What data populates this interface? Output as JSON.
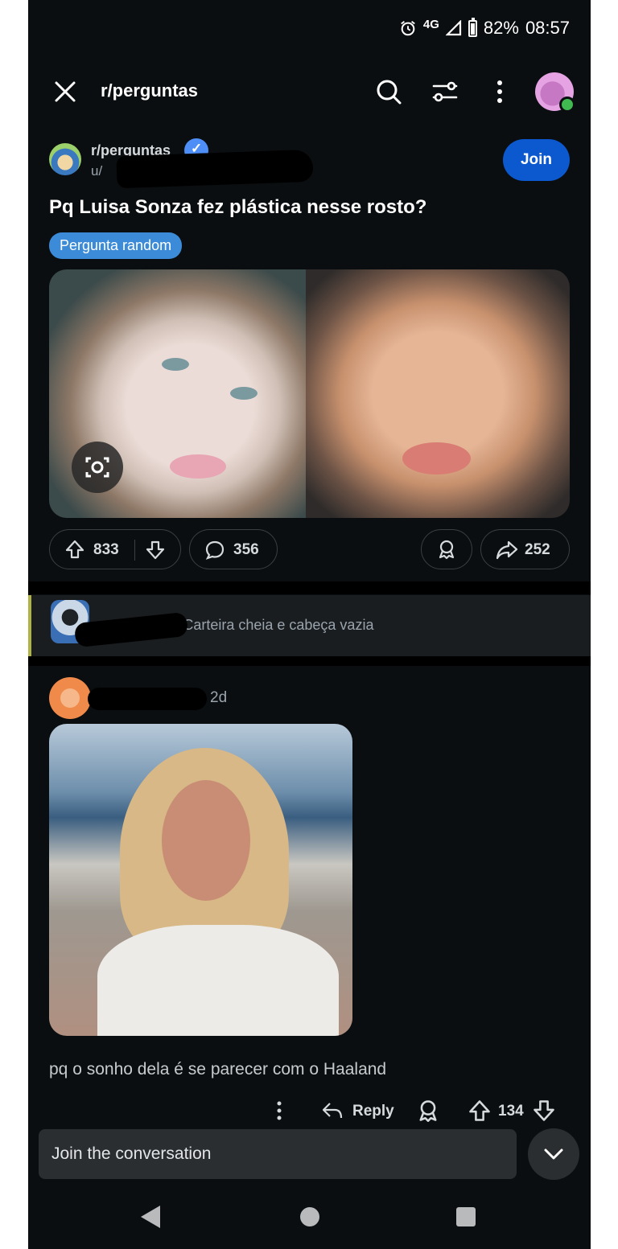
{
  "status_bar": {
    "network": "4G",
    "battery": "82%",
    "time": "08:57",
    "icons": [
      "alarm-icon",
      "signal-icon",
      "battery-icon"
    ]
  },
  "header": {
    "title": "r/perguntas",
    "icons": [
      "close-icon",
      "search-icon",
      "filter-icon",
      "more-icon",
      "avatar"
    ]
  },
  "post": {
    "subreddit": "r/perguntas",
    "user_prefix": "u/",
    "join_label": "Join",
    "title": "Pq Luisa Sonza fez plástica nesse rosto?",
    "flair": "Pergunta random",
    "upvotes": "833",
    "comments": "356",
    "shares": "252"
  },
  "collapsed_comment": {
    "meta": "2d • Carteira cheia e cabeça vazia"
  },
  "comment": {
    "time": "2d",
    "body": "pq o sonho dela é se parecer com o Haaland",
    "reply_label": "Reply",
    "score": "134"
  },
  "composer": {
    "placeholder": "Join the conversation"
  },
  "colors": {
    "background": "#0b0e10",
    "join": "#0b58cf",
    "flair": "#3c8bd9",
    "online": "#3fb950"
  }
}
